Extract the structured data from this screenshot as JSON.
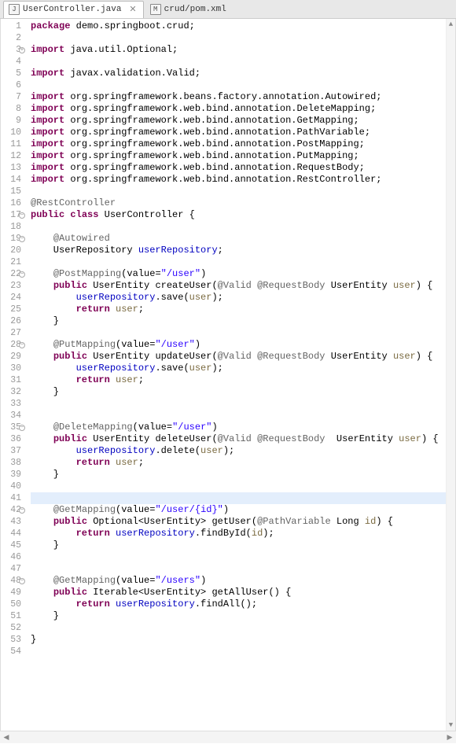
{
  "tabs": [
    {
      "label": "UserController.java",
      "iconLetter": "J",
      "active": true
    },
    {
      "label": "crud/pom.xml",
      "iconLetter": "M",
      "active": false
    }
  ],
  "highlightedLine": 41,
  "codeLines": [
    {
      "n": 1,
      "marker": "",
      "tokens": [
        [
          "kw",
          "package"
        ],
        [
          "plain",
          " demo.springboot.crud; "
        ]
      ]
    },
    {
      "n": 2,
      "marker": "",
      "tokens": []
    },
    {
      "n": 3,
      "marker": "expand",
      "tokens": [
        [
          "kw",
          "import"
        ],
        [
          "plain",
          " java.util.Optional; "
        ]
      ]
    },
    {
      "n": 4,
      "marker": "",
      "tokens": []
    },
    {
      "n": 5,
      "marker": "",
      "tokens": [
        [
          "kw",
          "import"
        ],
        [
          "plain",
          " javax.validation.Valid; "
        ]
      ]
    },
    {
      "n": 6,
      "marker": "",
      "tokens": []
    },
    {
      "n": 7,
      "marker": "",
      "tokens": [
        [
          "kw",
          "import"
        ],
        [
          "plain",
          " org.springframework.beans.factory.annotation.Autowired; "
        ]
      ]
    },
    {
      "n": 8,
      "marker": "",
      "tokens": [
        [
          "kw",
          "import"
        ],
        [
          "plain",
          " org.springframework.web.bind.annotation.DeleteMapping; "
        ]
      ]
    },
    {
      "n": 9,
      "marker": "",
      "tokens": [
        [
          "kw",
          "import"
        ],
        [
          "plain",
          " org.springframework.web.bind.annotation.GetMapping; "
        ]
      ]
    },
    {
      "n": 10,
      "marker": "",
      "tokens": [
        [
          "kw",
          "import"
        ],
        [
          "plain",
          " org.springframework.web.bind.annotation.PathVariable; "
        ]
      ]
    },
    {
      "n": 11,
      "marker": "",
      "tokens": [
        [
          "kw",
          "import"
        ],
        [
          "plain",
          " org.springframework.web.bind.annotation.PostMapping; "
        ]
      ]
    },
    {
      "n": 12,
      "marker": "",
      "tokens": [
        [
          "kw",
          "import"
        ],
        [
          "plain",
          " org.springframework.web.bind.annotation.PutMapping; "
        ]
      ]
    },
    {
      "n": 13,
      "marker": "",
      "tokens": [
        [
          "kw",
          "import"
        ],
        [
          "plain",
          " org.springframework.web.bind.annotation.RequestBody; "
        ]
      ]
    },
    {
      "n": 14,
      "marker": "",
      "tokens": [
        [
          "kw",
          "import"
        ],
        [
          "plain",
          " org.springframework.web.bind.annotation.RestController; "
        ]
      ]
    },
    {
      "n": 15,
      "marker": "",
      "tokens": []
    },
    {
      "n": 16,
      "marker": "",
      "tokens": [
        [
          "ann",
          "@RestController"
        ]
      ]
    },
    {
      "n": 17,
      "marker": "collapse",
      "tokens": [
        [
          "kw",
          "public"
        ],
        [
          "plain",
          " "
        ],
        [
          "kw",
          "class"
        ],
        [
          "plain",
          " UserController { "
        ]
      ]
    },
    {
      "n": 18,
      "marker": "",
      "tokens": []
    },
    {
      "n": 19,
      "marker": "collapse",
      "tokens": [
        [
          "plain",
          "    "
        ],
        [
          "ann",
          "@Autowired"
        ]
      ]
    },
    {
      "n": 20,
      "marker": "",
      "tokens": [
        [
          "plain",
          "    UserRepository "
        ],
        [
          "field",
          "userRepository"
        ],
        [
          "plain",
          "; "
        ]
      ]
    },
    {
      "n": 21,
      "marker": "",
      "tokens": []
    },
    {
      "n": 22,
      "marker": "collapse",
      "tokens": [
        [
          "plain",
          "    "
        ],
        [
          "ann",
          "@PostMapping"
        ],
        [
          "plain",
          "(value="
        ],
        [
          "str",
          "\"/user\""
        ],
        [
          "plain",
          ") "
        ]
      ]
    },
    {
      "n": 23,
      "marker": "",
      "tokens": [
        [
          "plain",
          "    "
        ],
        [
          "kw",
          "public"
        ],
        [
          "plain",
          " UserEntity createUser("
        ],
        [
          "ann",
          "@Valid"
        ],
        [
          "plain",
          " "
        ],
        [
          "ann",
          "@RequestBody"
        ],
        [
          "plain",
          " UserEntity "
        ],
        [
          "param",
          "user"
        ],
        [
          "plain",
          ") { "
        ]
      ]
    },
    {
      "n": 24,
      "marker": "",
      "tokens": [
        [
          "plain",
          "        "
        ],
        [
          "field",
          "userRepository"
        ],
        [
          "plain",
          ".save("
        ],
        [
          "param",
          "user"
        ],
        [
          "plain",
          "); "
        ]
      ]
    },
    {
      "n": 25,
      "marker": "",
      "tokens": [
        [
          "plain",
          "        "
        ],
        [
          "kw",
          "return"
        ],
        [
          "plain",
          " "
        ],
        [
          "param",
          "user"
        ],
        [
          "plain",
          "; "
        ]
      ]
    },
    {
      "n": 26,
      "marker": "",
      "tokens": [
        [
          "plain",
          "    } "
        ]
      ]
    },
    {
      "n": 27,
      "marker": "",
      "tokens": []
    },
    {
      "n": 28,
      "marker": "collapse",
      "tokens": [
        [
          "plain",
          "    "
        ],
        [
          "ann",
          "@PutMapping"
        ],
        [
          "plain",
          "(value="
        ],
        [
          "str",
          "\"/user\""
        ],
        [
          "plain",
          ") "
        ]
      ]
    },
    {
      "n": 29,
      "marker": "",
      "tokens": [
        [
          "plain",
          "    "
        ],
        [
          "kw",
          "public"
        ],
        [
          "plain",
          " UserEntity updateUser("
        ],
        [
          "ann",
          "@Valid"
        ],
        [
          "plain",
          " "
        ],
        [
          "ann",
          "@RequestBody"
        ],
        [
          "plain",
          " UserEntity "
        ],
        [
          "param",
          "user"
        ],
        [
          "plain",
          ") { "
        ]
      ]
    },
    {
      "n": 30,
      "marker": "",
      "tokens": [
        [
          "plain",
          "        "
        ],
        [
          "field",
          "userRepository"
        ],
        [
          "plain",
          ".save("
        ],
        [
          "param",
          "user"
        ],
        [
          "plain",
          "); "
        ]
      ]
    },
    {
      "n": 31,
      "marker": "",
      "tokens": [
        [
          "plain",
          "        "
        ],
        [
          "kw",
          "return"
        ],
        [
          "plain",
          " "
        ],
        [
          "param",
          "user"
        ],
        [
          "plain",
          "; "
        ]
      ]
    },
    {
      "n": 32,
      "marker": "",
      "tokens": [
        [
          "plain",
          "    } "
        ]
      ]
    },
    {
      "n": 33,
      "marker": "",
      "tokens": []
    },
    {
      "n": 34,
      "marker": "",
      "tokens": []
    },
    {
      "n": 35,
      "marker": "collapse",
      "tokens": [
        [
          "plain",
          "    "
        ],
        [
          "ann",
          "@DeleteMapping"
        ],
        [
          "plain",
          "(value="
        ],
        [
          "str",
          "\"/user\""
        ],
        [
          "plain",
          ") "
        ]
      ]
    },
    {
      "n": 36,
      "marker": "",
      "tokens": [
        [
          "plain",
          "    "
        ],
        [
          "kw",
          "public"
        ],
        [
          "plain",
          " UserEntity deleteUser("
        ],
        [
          "ann",
          "@Valid"
        ],
        [
          "plain",
          " "
        ],
        [
          "ann",
          "@RequestBody"
        ],
        [
          "plain",
          "  UserEntity "
        ],
        [
          "param",
          "user"
        ],
        [
          "plain",
          ") { "
        ]
      ]
    },
    {
      "n": 37,
      "marker": "",
      "tokens": [
        [
          "plain",
          "        "
        ],
        [
          "field",
          "userRepository"
        ],
        [
          "plain",
          ".delete("
        ],
        [
          "param",
          "user"
        ],
        [
          "plain",
          "); "
        ]
      ]
    },
    {
      "n": 38,
      "marker": "",
      "tokens": [
        [
          "plain",
          "        "
        ],
        [
          "kw",
          "return"
        ],
        [
          "plain",
          " "
        ],
        [
          "param",
          "user"
        ],
        [
          "plain",
          "; "
        ]
      ]
    },
    {
      "n": 39,
      "marker": "",
      "tokens": [
        [
          "plain",
          "    } "
        ]
      ]
    },
    {
      "n": 40,
      "marker": "",
      "tokens": []
    },
    {
      "n": 41,
      "marker": "",
      "tokens": [
        [
          "plain",
          "    "
        ]
      ]
    },
    {
      "n": 42,
      "marker": "collapse",
      "tokens": [
        [
          "plain",
          "    "
        ],
        [
          "ann",
          "@GetMapping"
        ],
        [
          "plain",
          "(value="
        ],
        [
          "str",
          "\"/user/{id}\""
        ],
        [
          "plain",
          ") "
        ]
      ]
    },
    {
      "n": 43,
      "marker": "",
      "tokens": [
        [
          "plain",
          "    "
        ],
        [
          "kw",
          "public"
        ],
        [
          "plain",
          " Optional<UserEntity> getUser("
        ],
        [
          "ann",
          "@PathVariable"
        ],
        [
          "plain",
          " Long "
        ],
        [
          "param",
          "id"
        ],
        [
          "plain",
          ") { "
        ]
      ]
    },
    {
      "n": 44,
      "marker": "",
      "tokens": [
        [
          "plain",
          "        "
        ],
        [
          "kw",
          "return"
        ],
        [
          "plain",
          " "
        ],
        [
          "field",
          "userRepository"
        ],
        [
          "plain",
          ".findById("
        ],
        [
          "param",
          "id"
        ],
        [
          "plain",
          "); "
        ]
      ]
    },
    {
      "n": 45,
      "marker": "",
      "tokens": [
        [
          "plain",
          "    } "
        ]
      ]
    },
    {
      "n": 46,
      "marker": "",
      "tokens": []
    },
    {
      "n": 47,
      "marker": "",
      "tokens": []
    },
    {
      "n": 48,
      "marker": "collapse",
      "tokens": [
        [
          "plain",
          "    "
        ],
        [
          "ann",
          "@GetMapping"
        ],
        [
          "plain",
          "(value="
        ],
        [
          "str",
          "\"/users\""
        ],
        [
          "plain",
          ") "
        ]
      ]
    },
    {
      "n": 49,
      "marker": "",
      "tokens": [
        [
          "plain",
          "    "
        ],
        [
          "kw",
          "public"
        ],
        [
          "plain",
          " Iterable<UserEntity> getAllUser() { "
        ]
      ]
    },
    {
      "n": 50,
      "marker": "",
      "tokens": [
        [
          "plain",
          "        "
        ],
        [
          "kw",
          "return"
        ],
        [
          "plain",
          " "
        ],
        [
          "field",
          "userRepository"
        ],
        [
          "plain",
          ".findAll(); "
        ]
      ]
    },
    {
      "n": 51,
      "marker": "",
      "tokens": [
        [
          "plain",
          "    } "
        ]
      ]
    },
    {
      "n": 52,
      "marker": "",
      "tokens": []
    },
    {
      "n": 53,
      "marker": "",
      "tokens": [
        [
          "plain",
          "} "
        ]
      ]
    },
    {
      "n": 54,
      "marker": "",
      "tokens": []
    }
  ]
}
